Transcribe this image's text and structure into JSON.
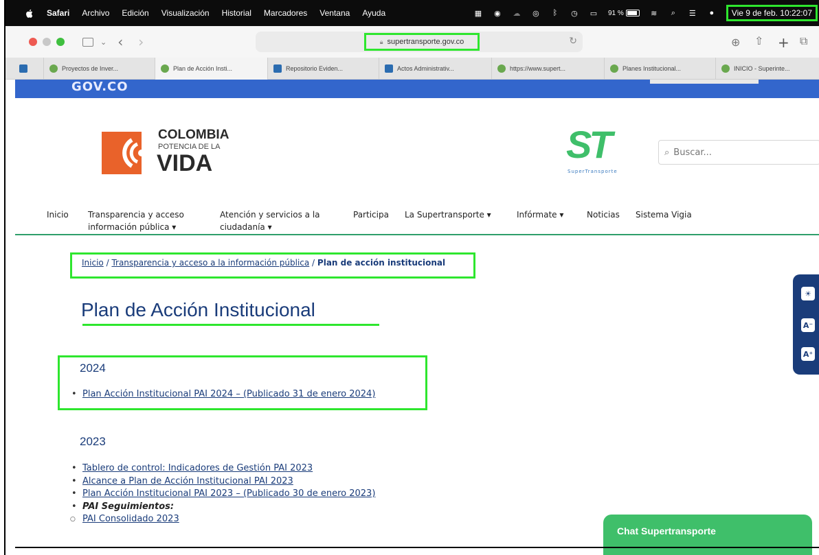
{
  "menubar": {
    "app": "Safari",
    "menus": [
      "Archivo",
      "Edición",
      "Visualización",
      "Historial",
      "Marcadores",
      "Ventana",
      "Ayuda"
    ],
    "battery": "91 %",
    "clock": "Vie 9 de feb.  10:22:07"
  },
  "browser": {
    "url": "supertransporte.gov.co",
    "tabs": [
      "Proyectos de Inver...",
      "Plan de Acción Insti...",
      "Repositorio Eviden...",
      "Actos Administrativ...",
      "https://www.supert...",
      "Planes Institucional...",
      "INICIO - Superinte..."
    ]
  },
  "site": {
    "gov_label": "GOV.CO",
    "logo": {
      "line1": "COLOMBIA",
      "line2": "POTENCIA DE LA",
      "line3": "VIDA"
    },
    "st_logo": {
      "mark": "ST",
      "caption": "SuperTransporte"
    },
    "search_placeholder": "Buscar...",
    "nav": {
      "inicio": "Inicio",
      "transparencia_1": "Transparencia y acceso",
      "transparencia_2": "información pública ▾",
      "atencion_1": "Atención y servicios a la",
      "atencion_2": "ciudadanía ▾",
      "participa": "Participa",
      "supertransporte": "La Supertransporte ▾",
      "informate": "Infórmate ▾",
      "noticias": "Noticias",
      "vigia": "Sistema Vigia"
    },
    "breadcrumb": {
      "home": "Inicio",
      "sep": " / ",
      "section": "Transparencia y acceso a la información pública",
      "current": "Plan de acción institucional"
    },
    "title": "Plan de Acción Institucional",
    "sections": {
      "y2024": {
        "year": "2024",
        "items": [
          "Plan Acción Institucional PAI 2024 – (Publicado 31 de enero 2024)"
        ]
      },
      "y2023": {
        "year": "2023",
        "items": [
          "Tablero de control: Indicadores de Gestión PAI 2023",
          "Alcance a Plan de Acción Institucional PAI 2023",
          "Plan Acción Institucional PAI 2023 – (Publicado 30 de enero 2023)"
        ],
        "followup_label": "PAI Seguimientos:",
        "followup_items": [
          "PAI Consolidado 2023"
        ]
      }
    },
    "chat_label": "Chat Supertransporte"
  }
}
